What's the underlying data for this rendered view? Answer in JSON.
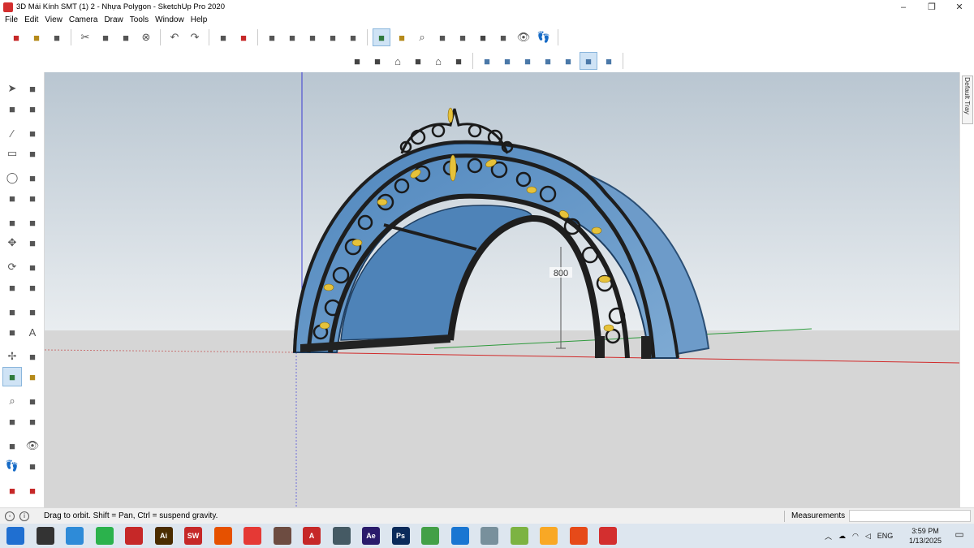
{
  "window": {
    "title": "3D Mái Kính SMT (1) 2 - Nhựa Polygon - SketchUp Pro 2020",
    "controls": [
      "–",
      "❐",
      "✕"
    ]
  },
  "menu": [
    "File",
    "Edit",
    "View",
    "Camera",
    "Draw",
    "Tools",
    "Window",
    "Help"
  ],
  "toolbar_top": {
    "groups": [
      [
        "new-model-icon",
        "open-icon",
        "save-icon"
      ],
      [
        "cut-icon",
        "copy-icon",
        "paste-icon",
        "erase-icon"
      ],
      [
        "undo-icon",
        "redo-icon"
      ],
      [
        "print-icon",
        "model-info-icon"
      ],
      [
        "make-component-icon",
        "component-icon-2",
        "component-icon-3",
        "component-icon-4",
        "component-icon-5"
      ],
      [
        "orbit-icon",
        "pan-icon",
        "zoom-icon",
        "zoom-window-icon",
        "zoom-extents-icon",
        "previous-view-icon",
        "position-camera-icon",
        "look-around-icon",
        "walk-icon"
      ]
    ],
    "active": "orbit-icon"
  },
  "toolbar_views": {
    "views": [
      "iso-view-icon",
      "top-view-icon",
      "front-view-icon",
      "right-view-icon",
      "back-view-icon",
      "left-view-icon"
    ],
    "styles": [
      "xray-icon",
      "back-edges-icon",
      "wireframe-icon",
      "hidden-line-icon",
      "shaded-icon",
      "shaded-textures-icon",
      "monochrome-icon"
    ],
    "active": "shaded-textures-icon"
  },
  "left_tools": [
    [
      "select-icon",
      "make-component-tool-icon"
    ],
    [
      "paint-bucket-icon",
      "eraser-icon"
    ],
    [
      "line-icon",
      "freehand-icon"
    ],
    [
      "rectangle-icon",
      "rotated-rectangle-icon"
    ],
    [
      "circle-icon",
      "polygon-icon"
    ],
    [
      "arc-icon",
      "two-point-arc-icon"
    ],
    [
      "three-point-arc-icon",
      "pie-icon"
    ],
    [
      "move-icon",
      "push-pull-icon"
    ],
    [
      "rotate-icon",
      "follow-me-icon"
    ],
    [
      "scale-icon",
      "offset-icon"
    ],
    [
      "tape-measure-icon",
      "dimension-icon"
    ],
    [
      "protractor-icon",
      "text-icon"
    ],
    [
      "axes-icon",
      "3d-text-icon"
    ],
    [
      "orbit-tool-icon",
      "pan-tool-icon"
    ],
    [
      "zoom-tool-icon",
      "zoom-window-tool-icon"
    ],
    [
      "zoom-extents-tool-icon",
      "previous-tool-icon"
    ],
    [
      "position-camera-tool-icon",
      "look-around-tool-icon"
    ],
    [
      "walk-tool-icon",
      "section-plane-icon"
    ],
    [
      "warehouse-icon",
      "extension-icon"
    ]
  ],
  "viewport": {
    "dimension_label": "800",
    "colors": {
      "sky_top": "#b9c6d1",
      "sky_bottom": "#e7ecef",
      "ground": "#d6d6d6",
      "glass": "#5f92c4",
      "iron": "#1e1e1e",
      "gold": "#e6c23a"
    }
  },
  "tray": {
    "label": "Default Tray"
  },
  "status": {
    "hint": "Drag to orbit. Shift = Pan, Ctrl = suspend gravity.",
    "measurements_label": "Measurements",
    "measurements_value": ""
  },
  "taskbar": {
    "apps": [
      {
        "name": "windows-start-icon",
        "label": "",
        "color": "#1f6fd1"
      },
      {
        "name": "search-icon",
        "label": "",
        "color": "#333333"
      },
      {
        "name": "app-icon-1",
        "label": "",
        "color": "#2e8bd8"
      },
      {
        "name": "app-icon-2",
        "label": "",
        "color": "#2bb24c"
      },
      {
        "name": "app-icon-3",
        "label": "",
        "color": "#c62828"
      },
      {
        "name": "illustrator-icon",
        "label": "Ai",
        "color": "#4a2c00"
      },
      {
        "name": "solidworks-icon",
        "label": "SW",
        "color": "#c62828"
      },
      {
        "name": "app-icon-4",
        "label": "",
        "color": "#e65100"
      },
      {
        "name": "chrome-icon",
        "label": "",
        "color": "#e53935"
      },
      {
        "name": "app-icon-5",
        "label": "",
        "color": "#6d4c41"
      },
      {
        "name": "autocad-icon",
        "label": "A",
        "color": "#c62828"
      },
      {
        "name": "calculator-icon",
        "label": "",
        "color": "#455a64"
      },
      {
        "name": "after-effects-icon",
        "label": "Ae",
        "color": "#2a1b6b"
      },
      {
        "name": "photoshop-icon",
        "label": "Ps",
        "color": "#0b2a5a"
      },
      {
        "name": "app-icon-6",
        "label": "",
        "color": "#43a047"
      },
      {
        "name": "edge-icon",
        "label": "",
        "color": "#1976d2"
      },
      {
        "name": "app-icon-7",
        "label": "",
        "color": "#78909c"
      },
      {
        "name": "app-icon-8",
        "label": "",
        "color": "#7cb342"
      },
      {
        "name": "file-explorer-icon",
        "label": "",
        "color": "#f9a825"
      },
      {
        "name": "app-icon-9",
        "label": "",
        "color": "#e64a19"
      },
      {
        "name": "sketchup-taskbar-icon",
        "label": "",
        "color": "#d32f2f"
      }
    ],
    "tray": {
      "language": "ENG",
      "time": "3:59 PM",
      "date": "1/13/2025"
    }
  }
}
